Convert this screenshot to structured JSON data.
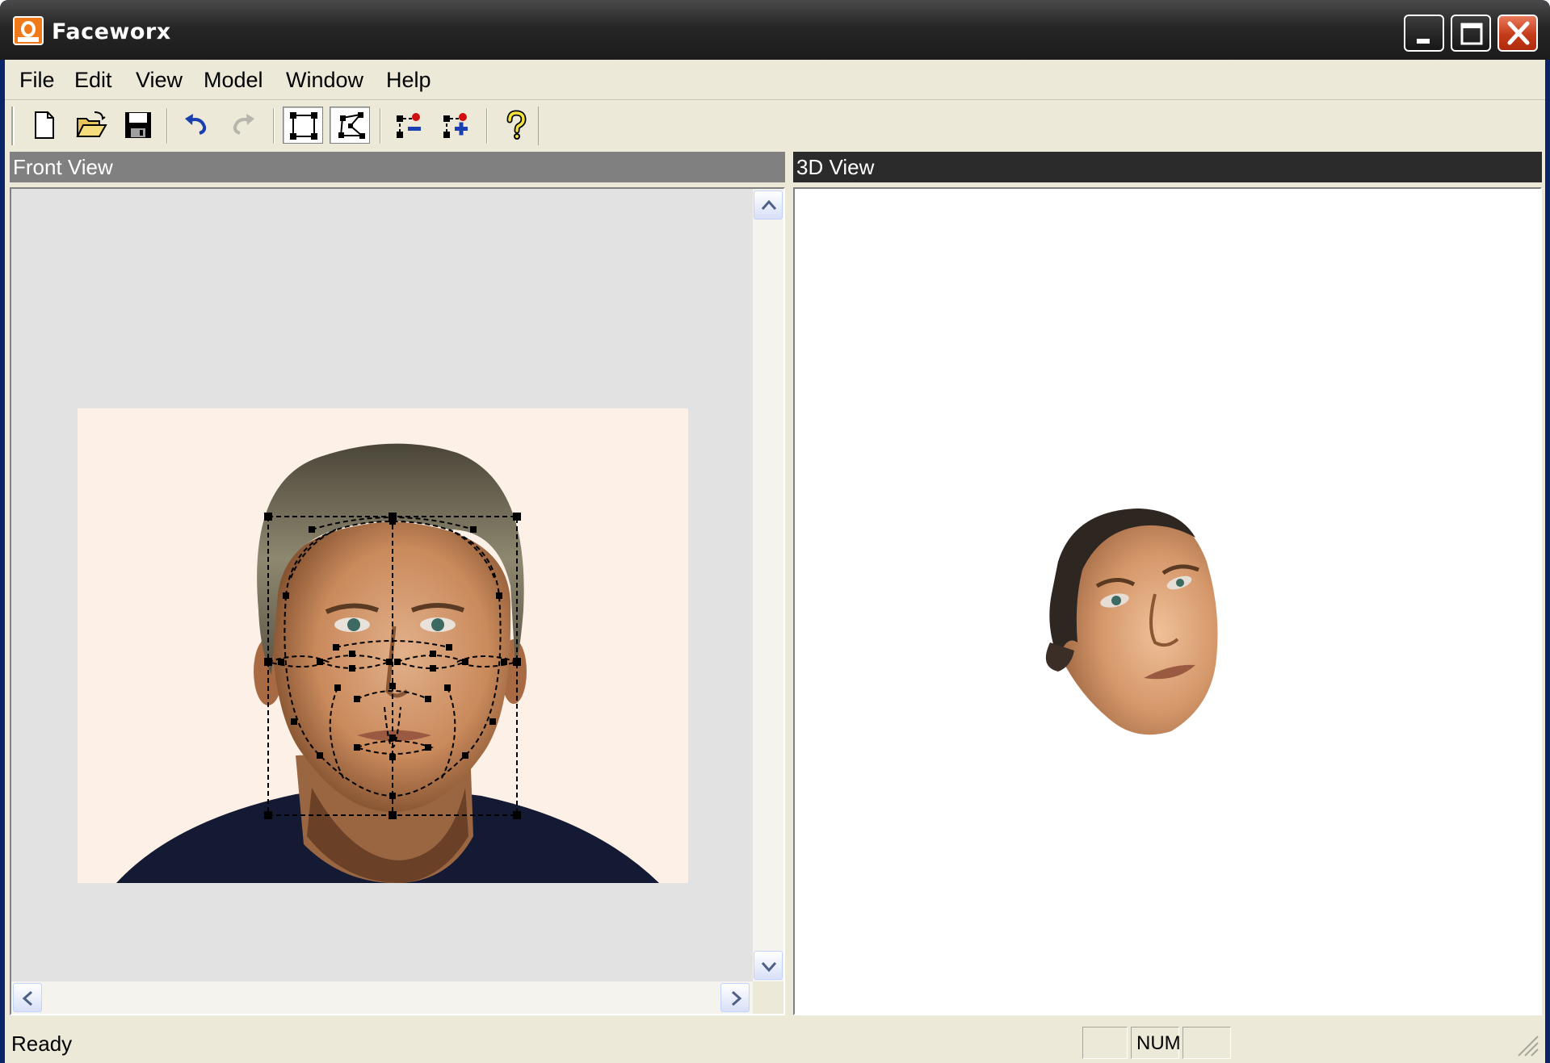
{
  "window": {
    "title": "Faceworx",
    "icon": "faceworx-app-icon",
    "controls": [
      "minimize-icon",
      "maximize-icon",
      "close-icon"
    ]
  },
  "menu": {
    "items": [
      {
        "label": "File"
      },
      {
        "label": "Edit"
      },
      {
        "label": "View"
      },
      {
        "label": "Model"
      },
      {
        "label": "Window"
      },
      {
        "label": "Help"
      }
    ]
  },
  "toolbar": {
    "buttons": [
      {
        "name": "new-file-icon"
      },
      {
        "name": "open-folder-icon"
      },
      {
        "name": "save-icon"
      },
      {
        "name": "undo-icon"
      },
      {
        "name": "redo-icon",
        "disabled": true
      },
      {
        "name": "select-rectangle-icon",
        "pressed": true
      },
      {
        "name": "select-polygon-icon",
        "pressed": true
      },
      {
        "name": "remove-point-icon"
      },
      {
        "name": "add-point-icon"
      },
      {
        "name": "help-icon"
      }
    ]
  },
  "panes": {
    "front": {
      "title": "Front View"
    },
    "three_d": {
      "title": "3D View"
    }
  },
  "status": {
    "text": "Ready",
    "indicators": [
      "",
      "NUM",
      ""
    ]
  },
  "colors": {
    "titlebar": "#262626",
    "front_header": "#808080",
    "three_d_header": "#2b2b2b",
    "photo_background": "#fdf0e6",
    "control_point": "#000000"
  }
}
